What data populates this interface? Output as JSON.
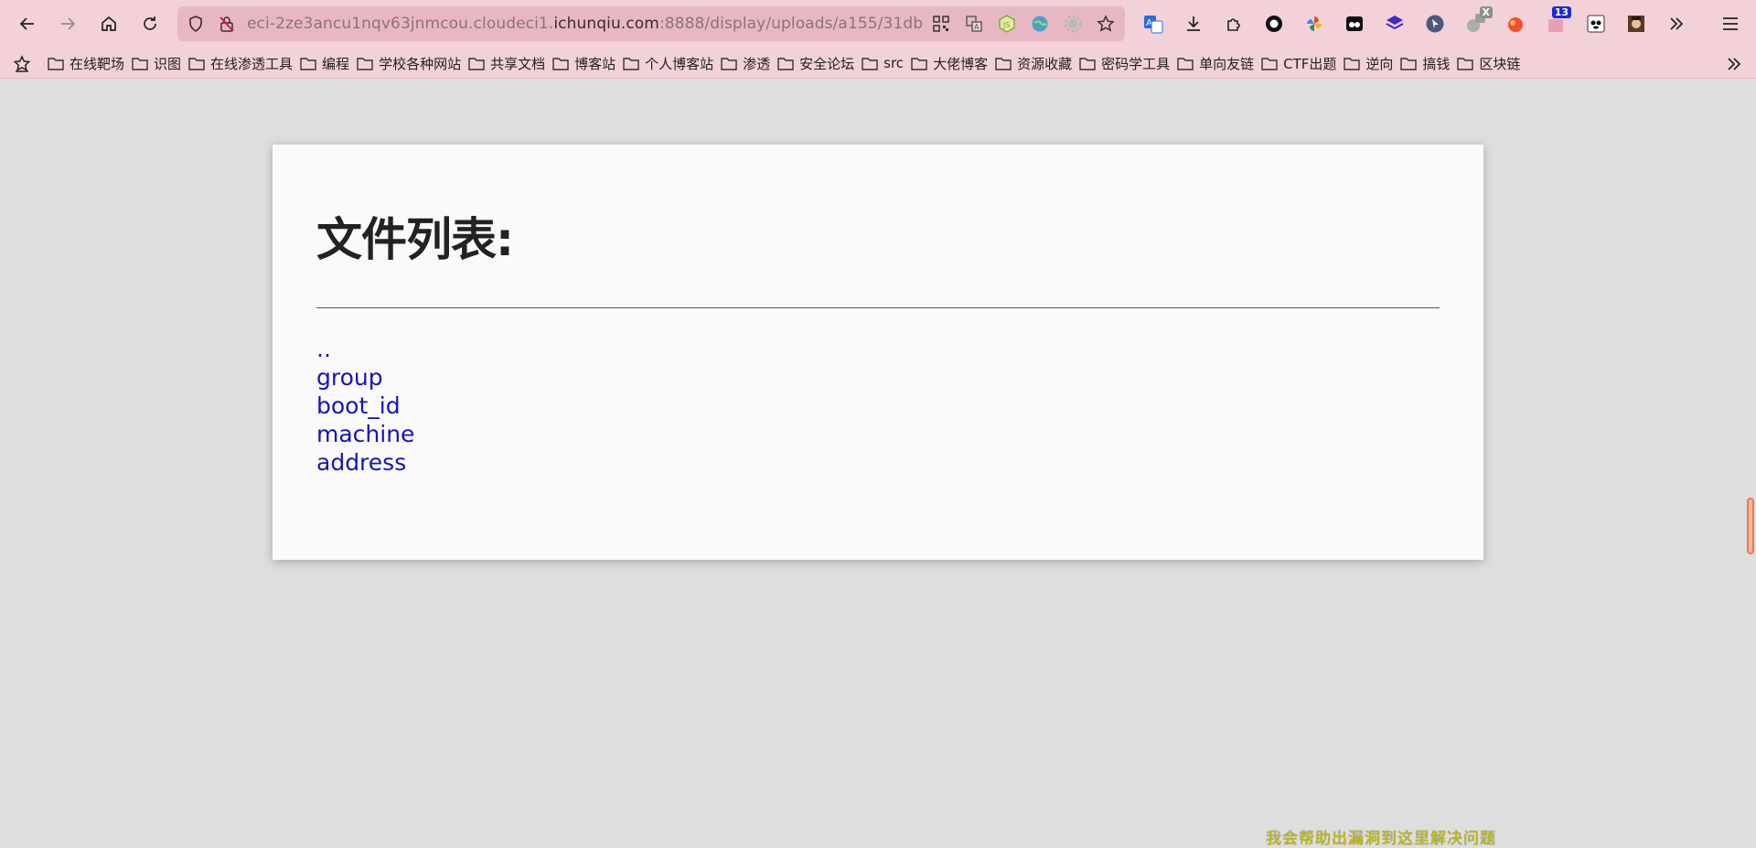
{
  "browser": {
    "url_prefix": "eci-2ze3ancu1nqv63jnmcou.cloudeci1.",
    "url_host": "ichunqiu.com",
    "url_path": ":8888/display/uploads/a155/31db",
    "icons": {
      "back": "arrow-left-icon",
      "forward": "arrow-right-icon",
      "home": "home-icon",
      "reload": "reload-icon",
      "menu": "hamburger-icon"
    },
    "extension_badge": "13",
    "extension_x_label": "X"
  },
  "bookmarks": [
    {
      "label": "在线靶场"
    },
    {
      "label": "识图"
    },
    {
      "label": "在线渗透工具"
    },
    {
      "label": "编程"
    },
    {
      "label": "学校各种网站"
    },
    {
      "label": "共享文档"
    },
    {
      "label": "博客站"
    },
    {
      "label": "个人博客站"
    },
    {
      "label": "渗透"
    },
    {
      "label": "安全论坛"
    },
    {
      "label": "src"
    },
    {
      "label": "大佬博客"
    },
    {
      "label": "资源收藏"
    },
    {
      "label": "密码学工具"
    },
    {
      "label": "单向友链"
    },
    {
      "label": "CTF出题"
    },
    {
      "label": "逆向"
    },
    {
      "label": "搞钱"
    },
    {
      "label": "区块链"
    }
  ],
  "page": {
    "title": "文件列表:",
    "files": [
      {
        "name": ".."
      },
      {
        "name": "group"
      },
      {
        "name": "boot_id"
      },
      {
        "name": "machine"
      },
      {
        "name": "address"
      }
    ],
    "bottom_overlay": "我会帮助出漏洞到这里解决问题"
  },
  "colors": {
    "chrome_bg": "#f2d1d8",
    "urlbar_bg": "#e8b8c2",
    "page_bg": "#dedede",
    "card_bg": "#fafafa",
    "link": "#1515b8"
  }
}
